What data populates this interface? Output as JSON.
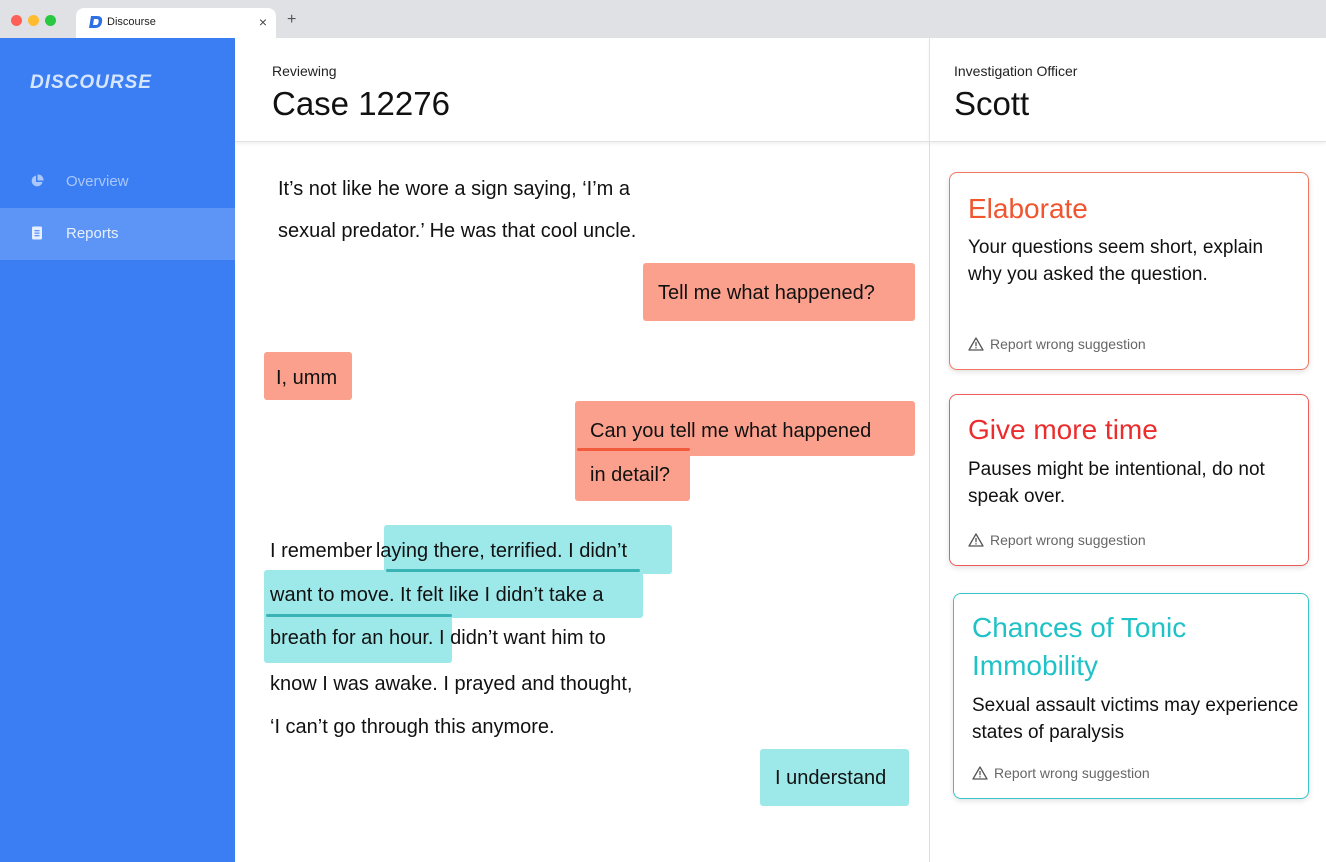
{
  "browser": {
    "tab_title": "Discourse",
    "tab_close": "×",
    "new_tab": "+"
  },
  "sidebar": {
    "logo": "DISCOURSE",
    "items": [
      {
        "label": "Overview",
        "icon": "pie-chart-icon",
        "active": false
      },
      {
        "label": "Reports",
        "icon": "document-icon",
        "active": true
      }
    ]
  },
  "header": {
    "reviewing_label": "Reviewing",
    "case_title": "Case 12276",
    "officer_label": "Investigation Officer",
    "officer_name": "Scott"
  },
  "transcript": {
    "intro_line1": "It’s not like he wore a sign saying, ‘I’m a",
    "intro_line2": "sexual predator.’ He was that cool uncle.",
    "officer_q1": "Tell me what happened?",
    "victim_a1": "I, umm",
    "officer_q2_line1": "Can you tell me what happened",
    "officer_q2_line2": "in detail?",
    "victim_a2_line1_plain": "I remember ",
    "victim_a2_line1_hl": "laying there, terrified. I didn’t",
    "victim_a2_line2_hl": "want to move. It felt like I didn’t take a",
    "victim_a2_line3_hl": "breath for an hour.",
    "victim_a2_line3_plain": " I didn’t want him to",
    "victim_a2_line4": "know I was awake. I prayed and thought,",
    "victim_a2_line5": "‘I can’t go through this anymore.",
    "officer_r1": "I understand"
  },
  "suggestions": [
    {
      "title": "Elaborate",
      "body": "Your questions seem short, explain why you asked the question.",
      "report": "Report wrong suggestion",
      "color": "#f0552f"
    },
    {
      "title": "Give more time",
      "body": "Pauses might be intentional, do not speak over.",
      "report": "Report wrong suggestion",
      "color": "#ec2d2d"
    },
    {
      "title": "Chances of Tonic Immobility",
      "body": "Sexual assault victims may experience states of paralysis",
      "report": "Report wrong suggestion",
      "color": "#1fc2c6"
    }
  ],
  "colors": {
    "sidebar_bg": "#3b7ef3",
    "highlight_salmon": "#fba08c",
    "highlight_cyan": "#9de8e9"
  }
}
